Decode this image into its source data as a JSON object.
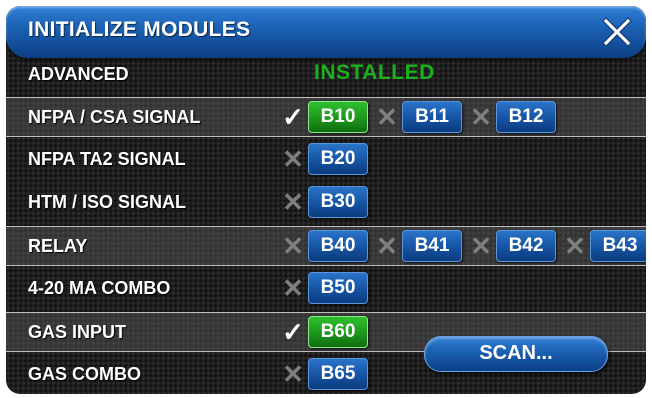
{
  "header": {
    "title": "INITIALIZE MODULES",
    "close_icon": "close-x-icon"
  },
  "status": {
    "label": "ADVANCED",
    "value": "INSTALLED",
    "color": "#1db01d"
  },
  "rows": [
    {
      "label": "NFPA / CSA SIGNAL",
      "modules": [
        {
          "id": "B10",
          "mark": "check",
          "state": "installed"
        },
        {
          "id": "B11",
          "mark": "cross",
          "state": "not-installed"
        },
        {
          "id": "B12",
          "mark": "cross",
          "state": "not-installed"
        }
      ]
    },
    {
      "label": "NFPA TA2 SIGNAL",
      "modules": [
        {
          "id": "B20",
          "mark": "cross",
          "state": "not-installed"
        }
      ]
    },
    {
      "label": "HTM / ISO SIGNAL",
      "modules": [
        {
          "id": "B30",
          "mark": "cross",
          "state": "not-installed"
        }
      ]
    },
    {
      "label": "RELAY",
      "modules": [
        {
          "id": "B40",
          "mark": "cross",
          "state": "not-installed"
        },
        {
          "id": "B41",
          "mark": "cross",
          "state": "not-installed"
        },
        {
          "id": "B42",
          "mark": "cross",
          "state": "not-installed"
        },
        {
          "id": "B43",
          "mark": "cross",
          "state": "not-installed"
        }
      ]
    },
    {
      "label": "4-20 MA COMBO",
      "modules": [
        {
          "id": "B50",
          "mark": "cross",
          "state": "not-installed"
        }
      ]
    },
    {
      "label": "GAS INPUT",
      "modules": [
        {
          "id": "B60",
          "mark": "check",
          "state": "installed"
        }
      ]
    },
    {
      "label": "GAS COMBO",
      "modules": [
        {
          "id": "B65",
          "mark": "cross",
          "state": "not-installed"
        }
      ]
    }
  ],
  "marks": {
    "check": "✓",
    "cross": "✕"
  },
  "scan_button": {
    "label": "SCAN..."
  },
  "colors": {
    "installed": "#1e9a1e",
    "not_installed": "#1756a6",
    "title_bar": "#1a5fb0"
  }
}
